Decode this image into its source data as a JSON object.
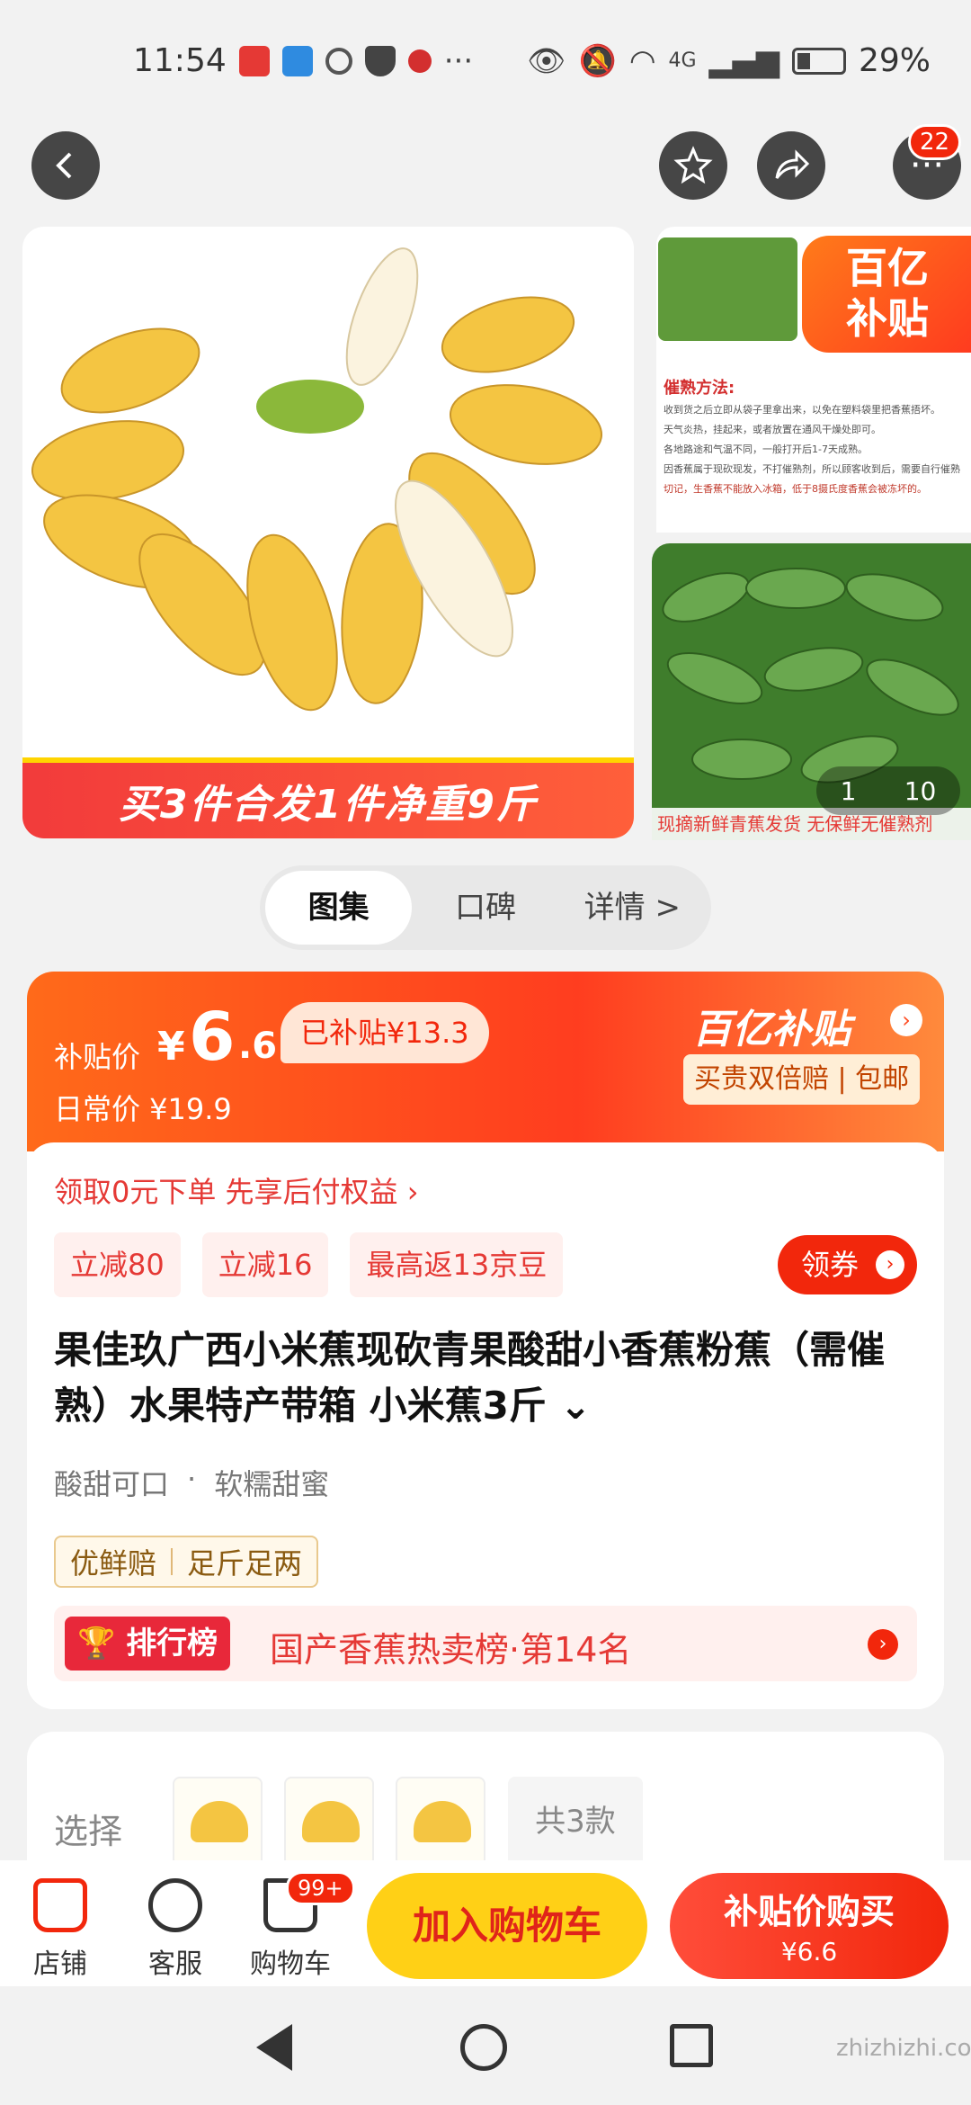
{
  "status_bar": {
    "time": "11:54",
    "more_indicator": "···",
    "network": "4G",
    "battery_percent": "29%"
  },
  "top_nav": {
    "back_icon": "chevron-left-icon",
    "fav_icon": "star-icon",
    "share_icon": "share-icon",
    "more_icon": "more-icon",
    "notification_count": "22"
  },
  "gallery": {
    "main_caption": "买3件合发1件净重9斤",
    "sticker_text_line1": "百亿",
    "sticker_text_line2": "补贴",
    "ripen_title": "催熟方法:",
    "ripen_lines": [
      "收到货之后立即从袋子里拿出来，以免在塑料袋里把香蕉捂坏。",
      "天气炎热，挂起来，或者放置在通风干燥处即可。",
      "各地路途和气温不同，一般打开后1-7天成熟。",
      "因香蕉属于现砍现发，不打催熟剂，所以顾客收到后，需要自行催熟。",
      "切记，生香蕉不能放入冰箱，低于8摄氏度香蕉会被冻坏的。"
    ],
    "side_caption": "现摘新鲜青蕉发货 无保鲜无催熟剂",
    "page_current": "1",
    "page_total": "10"
  },
  "tabs": [
    {
      "label": "图集",
      "active": true
    },
    {
      "label": "口碑",
      "active": false
    },
    {
      "label": "详情 >",
      "active": false
    }
  ],
  "price": {
    "subsidy_label": "补贴价",
    "yen": "¥",
    "integer": "6",
    "decimal": ".6",
    "subsidized": "已补贴¥13.3",
    "daily": "日常价 ¥19.9",
    "brand": "百亿补贴",
    "brand_arrow": "›",
    "brand_tag": "买贵双倍赔 | 包邮"
  },
  "promo": {
    "line": "领取0元下单 先享后付权益 ›",
    "coupons": [
      "立减80",
      "立减16",
      "最高返13京豆"
    ],
    "get_coupon": "领券",
    "get_coupon_arrow": "›"
  },
  "product": {
    "title": "果佳玖广西小米蕉现砍青果酸甜小香蕉粉蕉（需催熟）水果特产带箱 小米蕉3斤 ⌄",
    "traits": [
      "酸甜可口",
      "·",
      "软糯甜蜜"
    ],
    "guarantees": [
      "优鲜赔",
      "足斤足两"
    ],
    "rank_badge": "排行榜",
    "rank_text": "国产香蕉热卖榜·第14名",
    "rank_arrow": "›"
  },
  "variants": {
    "label": "选择",
    "total": "共3款"
  },
  "action_bar": {
    "store": "店铺",
    "service": "客服",
    "cart": "购物车",
    "cart_badge": "99+",
    "add_to_cart": "加入购物车",
    "buy_title": "补贴价购买",
    "buy_price": "¥6.6"
  },
  "watermark": "zhizhizhi.com",
  "colors": {
    "accent_red": "#f2270c",
    "accent_orange": "#ff6a1a",
    "add_cart_yellow": "#ffd016"
  }
}
